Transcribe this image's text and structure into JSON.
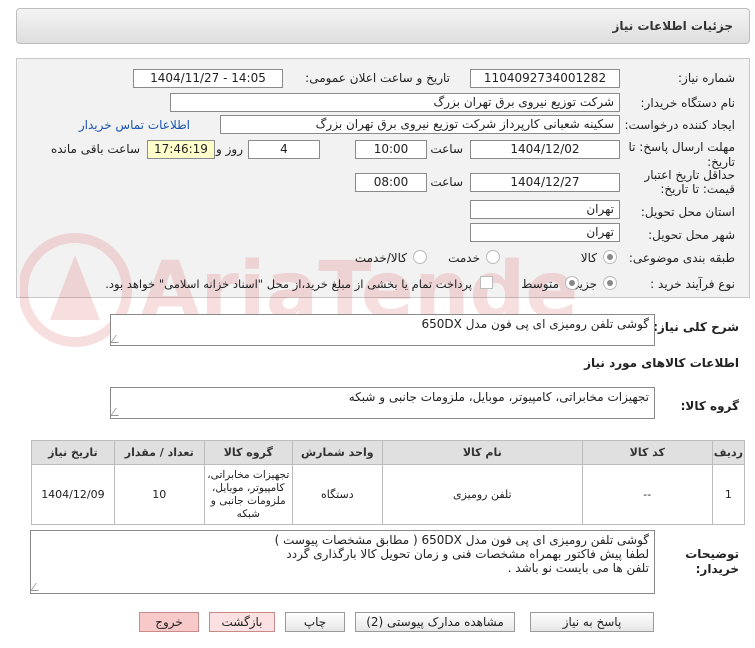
{
  "header": {
    "title": "جزئیات اطلاعات نیاز"
  },
  "watermark": {
    "text": "AriaTender.neT"
  },
  "fields": {
    "need_number_label": "شماره نیاز:",
    "need_number": "1104092734001282",
    "announce_label": "تاریخ و ساعت اعلان عمومی:",
    "announce_value": "1404/11/27 - 14:05",
    "buyer_org_label": "نام دستگاه خریدار:",
    "buyer_org": "شرکت توزیع نیروی برق تهران بزرگ",
    "creator_label": "ایجاد کننده درخواست:",
    "creator": "سکینه شعبانی کارپرداز شرکت توزیع نیروی برق تهران بزرگ",
    "contact_link": "اطلاعات تماس خریدار",
    "deadline_label_1": "مهلت ارسال پاسخ: تا",
    "deadline_label_2": "تاریخ:",
    "deadline_date": "1404/12/02",
    "time_word": "ساعت",
    "deadline_time": "10:00",
    "days": "4",
    "day_and": "روز و",
    "remaining_time": "17:46:19",
    "remaining_label": "ساعت باقی مانده",
    "validity_label_1": "حداقل تاریخ اعتبار",
    "validity_label_2": "قیمت: تا تاریخ:",
    "validity_date": "1404/12/27",
    "validity_time": "08:00",
    "province_label": "استان محل تحویل:",
    "province": "تهران",
    "city_label": "شهر محل تحویل:",
    "city": "تهران",
    "category_label": "طبقه بندی موضوعی:",
    "category_options": [
      "کالا",
      "خدمت",
      "کالا/خدمت"
    ],
    "category_selected": "کالا",
    "purchase_type_label": "نوع فرآیند خرید :",
    "purchase_options": [
      "جزیی",
      "متوسط"
    ],
    "purchase_selected": "جزیی",
    "payment_note": "پرداخت تمام یا بخشی از مبلغ خرید،از محل \"اسناد خزانه اسلامی\" خواهد بود."
  },
  "summary": {
    "label": "شرح کلی نیاز:",
    "value": "گوشی تلفن رومیزی ای پی فون مدل 650DX"
  },
  "goods_info": {
    "title": "اطلاعات کالاهای مورد نیاز",
    "group_label": "گروه کالا:",
    "group_value": "تجهیزات مخابراتی، کامپیوتر، موبایل، ملزومات جانبی و شبکه"
  },
  "table": {
    "headers": [
      "ردیف",
      "کد کالا",
      "نام کالا",
      "واحد شمارش",
      "گروه کالا",
      "تعداد / مقدار",
      "تاریخ نیاز"
    ],
    "rows": [
      [
        "1",
        "--",
        "تلفن رومیزی",
        "دستگاه",
        "تجهیزات مخابراتی، کامپیوتر، موبایل، ملزومات جانبی و شبکه",
        "10",
        "1404/12/09"
      ]
    ]
  },
  "buyer_notes": {
    "label_1": "توضیحات",
    "label_2": "خریدار:",
    "lines": [
      "گوشی تلفن رومیزی ای پی فون مدل 650DX ( مطابق مشخصات پیوست )",
      "لطفا پیش فاکتور بهمراه مشخصات فنی و زمان تحویل کالا بارگذاری گردد",
      "تلفن ها می بایست نو باشد ."
    ]
  },
  "buttons": {
    "reply": "پاسخ به نیاز",
    "docs": "مشاهده مدارک پیوستی (2)",
    "print": "چاپ",
    "back": "بازگشت",
    "exit": "خروج"
  },
  "colors": {
    "link": "#1a55b0",
    "remaining_bg": "#ffffcc",
    "exit_bg": "#f7c9c9"
  }
}
